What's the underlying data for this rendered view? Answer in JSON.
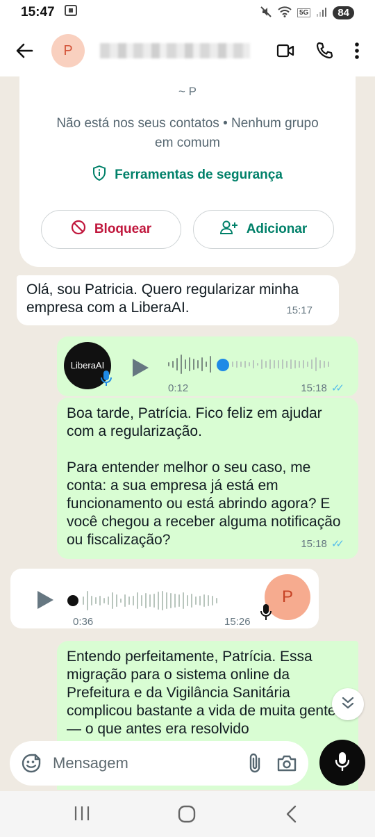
{
  "status_bar": {
    "time": "15:47",
    "network": "5G",
    "battery": "84"
  },
  "app_bar": {
    "avatar_letter": "P"
  },
  "contact_card": {
    "name": "~ P",
    "info": "Não está nos seus contatos • Nenhum grupo em comum",
    "safety_tools": "Ferramentas de segurança",
    "block_label": "Bloquear",
    "add_label": "Adicionar"
  },
  "messages": {
    "m1": {
      "text": "Olá, sou Patricia. Quero regularizar minha empresa com a LiberaAI.",
      "time": "15:17"
    },
    "voice1": {
      "logo_text": "LiberaAI",
      "duration": "0:12",
      "time": "15:18"
    },
    "m2": {
      "text": "Boa tarde, Patrícia. Fico feliz em ajudar com a regularização.\n\nPara entender melhor o seu caso, me conta: a sua empresa já está em funcionamento ou está abrindo agora? E você chegou a receber alguma notificação ou fiscalização?",
      "time": "15:18"
    },
    "voice2": {
      "duration": "0:36",
      "time": "15:26",
      "avatar_letter": "P"
    },
    "m3": {
      "text": "Entendo perfeitamente, Patrícia. Essa migração para o sistema online da Prefeitura e da Vigilância Sanitária complicou bastante a vida de muita gente — o que antes era resolvido"
    }
  },
  "input_bar": {
    "placeholder": "Mensagem"
  },
  "colors": {
    "outgoing": "#d9fdd3",
    "incoming": "#ffffff",
    "background": "#efeae2",
    "accent": "#008069",
    "danger": "#c0163c",
    "tick": "#53bdeb"
  }
}
